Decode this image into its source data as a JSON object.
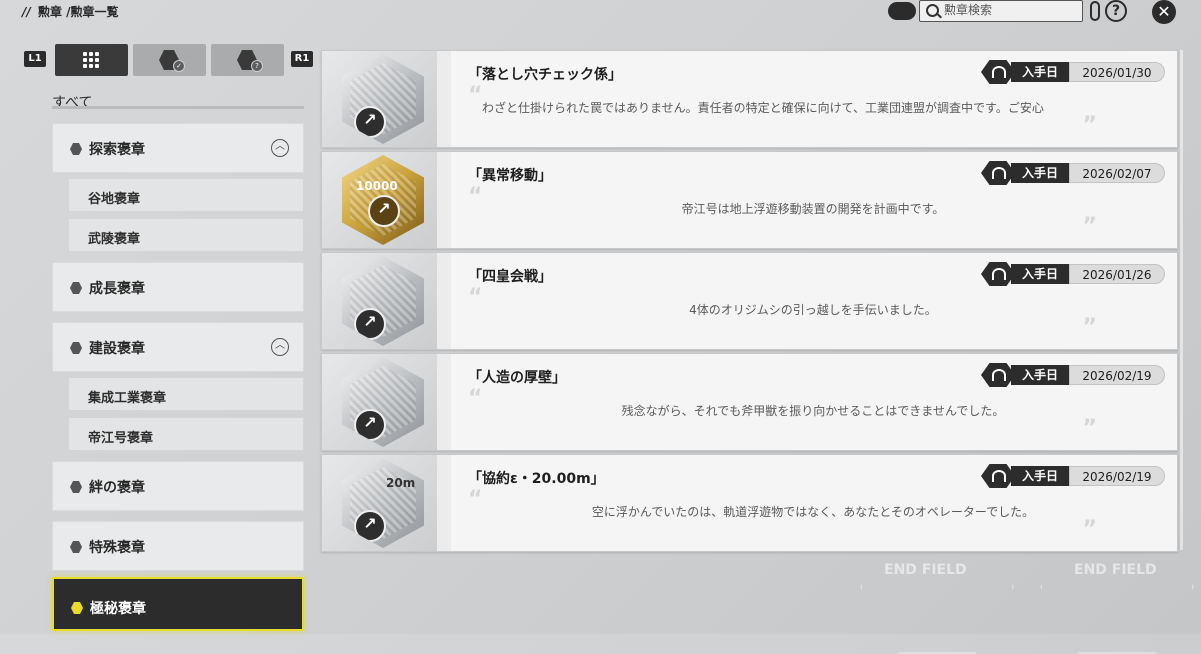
{
  "header": {
    "breadcrumb_sep": "//",
    "breadcrumb": "勲章 /勲章一覧",
    "search_placeholder": "勲章検索",
    "help_symbol": "?",
    "close_symbol": "✕"
  },
  "tabs": {
    "left_bumper": "L1",
    "right_bumper": "R1",
    "items": [
      {
        "icon": "grid-icon",
        "active": true
      },
      {
        "icon": "medal-check-icon",
        "active": false
      },
      {
        "icon": "medal-question-icon",
        "active": false
      }
    ]
  },
  "sidebar": {
    "all_label": "すべて",
    "categories": [
      {
        "label": "探索褒章",
        "icon": "map-pin-icon",
        "expanded": true,
        "subs": [
          "谷地褒章",
          "武陵褒章"
        ]
      },
      {
        "label": "成長褒章",
        "icon": "growth-icon",
        "expanded": false,
        "subs": []
      },
      {
        "label": "建設褒章",
        "icon": "cube-icon",
        "expanded": true,
        "subs": [
          "集成工業褒章",
          "帝江号褒章"
        ]
      },
      {
        "label": "絆の褒章",
        "icon": "puzzle-icon",
        "expanded": false,
        "subs": []
      },
      {
        "label": "特殊褒章",
        "icon": "shield-icon",
        "expanded": false,
        "subs": []
      },
      {
        "label": "極秘褒章",
        "icon": "secret-icon",
        "expanded": false,
        "selected": true,
        "subs": []
      }
    ],
    "collapse_symbol": "︿"
  },
  "medals": [
    {
      "title": "「落とし穴チェック係」",
      "acquired_label": "入手日",
      "date": "2026/01/30",
      "desc": "わざと仕掛けられた罠ではありません。責任者の特定と確保に向けて、工業団連盟が調査中です。ご安心",
      "style": "silver"
    },
    {
      "title": "「異常移動」",
      "acquired_label": "入手日",
      "date": "2026/02/07",
      "desc": "帝江号は地上浮遊移動装置の開発を計画中です。",
      "style": "gold",
      "medal_text": "10000"
    },
    {
      "title": "「四皇会戦」",
      "acquired_label": "入手日",
      "date": "2026/01/26",
      "desc": "4体のオリジムシの引っ越しを手伝いました。",
      "style": "silver"
    },
    {
      "title": "「人造の厚壁」",
      "acquired_label": "入手日",
      "date": "2026/02/19",
      "desc": "残念ながら、それでも斧甲獣を振り向かせることはできませんでした。",
      "style": "silver"
    },
    {
      "title": "「協約ε・20.00m」",
      "acquired_label": "入手日",
      "date": "2026/02/19",
      "desc": "空に浮かんでいたのは、軌道浮遊物ではなく、あなたとそのオペレーターでした。",
      "style": "silver",
      "medal_text": "20m"
    }
  ],
  "watermark": "END FIELD",
  "colors": {
    "selected_border": "#e8dc2a",
    "dark": "#2c2c2c"
  }
}
